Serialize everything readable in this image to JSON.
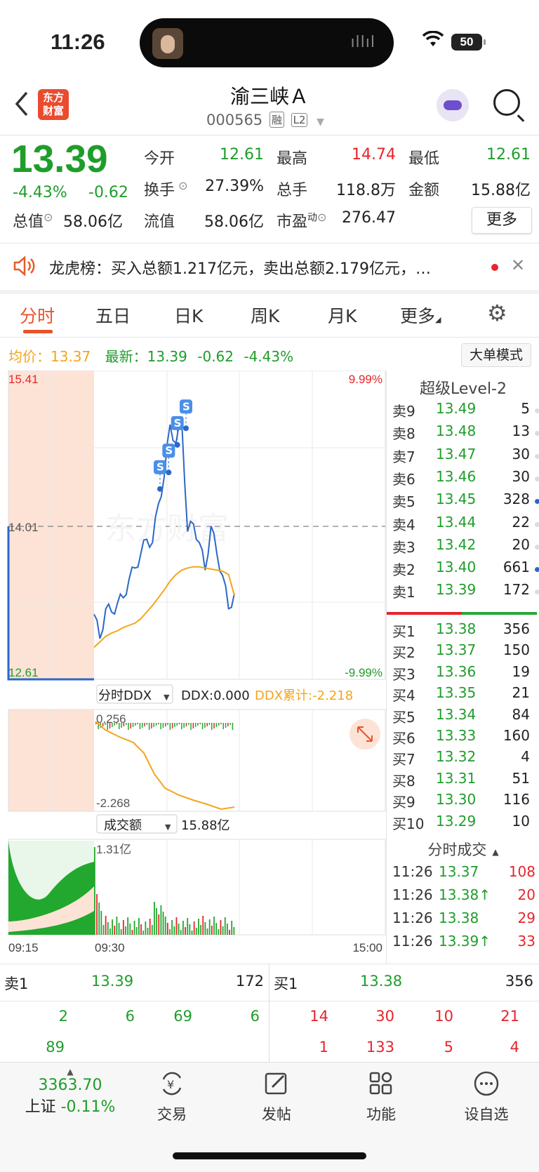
{
  "status": {
    "time": "11:26",
    "battery": "50"
  },
  "header": {
    "back_icon": "chevron-left-icon",
    "logo_line1": "东方",
    "logo_line2": "财富",
    "stock_name": "渝三峡Ａ",
    "stock_code": "000565",
    "tag_margin": "融",
    "tag_l2": "L2"
  },
  "quote": {
    "price": "13.39",
    "pct": "-4.43%",
    "change": "-0.62",
    "open_label": "今开",
    "open": "12.61",
    "high_label": "最高",
    "high": "14.74",
    "low_label": "最低",
    "low": "12.61",
    "turnover_label": "换手",
    "turnover": "27.39%",
    "volume_label": "总手",
    "volume": "118.8万",
    "amount_label": "金额",
    "amount": "15.88亿",
    "mktcap_label": "总值",
    "mktcap": "58.06亿",
    "float_label": "流值",
    "float": "58.06亿",
    "pe_label": "市盈",
    "pe_sup": "动",
    "pe": "276.47",
    "more_button": "更多"
  },
  "dragon_tiger": {
    "text": "龙虎榜：买入总额1.217亿元，卖出总额2.179亿元，…"
  },
  "tabs": [
    "分时",
    "五日",
    "日K",
    "周K",
    "月K",
    "更多"
  ],
  "intraday": {
    "avg_label": "均价：",
    "avg": "13.37",
    "latest_label": "最新：",
    "latest": "13.39",
    "change": "-0.62",
    "pct": "-4.43%",
    "big_order_button": "大单模式",
    "y_max": "15.41",
    "y_mid": "14.01",
    "y_min": "12.61",
    "pct_max": "9.99%",
    "pct_min": "-9.99%",
    "ddx_selector": "分时DDX",
    "ddx_value": "DDX:0.000",
    "ddx_cum": "DDX累计:-2.218",
    "ddx_top": "0.256",
    "ddx_bottom": "-2.268",
    "vol_selector": "成交额",
    "vol_total": "15.88亿",
    "vol_max": "1.31亿",
    "t_start": "09:15",
    "t_open": "09:30",
    "t_end": "15:00",
    "signal_label": "S"
  },
  "chart_data": {
    "type": "line",
    "title": "",
    "xlabel": "",
    "ylabel": "",
    "ylim": [
      12.61,
      15.41
    ],
    "x": [
      "09:30",
      "09:33",
      "09:36",
      "09:40",
      "09:45",
      "09:50",
      "09:55",
      "10:00",
      "10:05",
      "10:10",
      "10:15",
      "10:20",
      "10:25",
      "10:30",
      "10:35",
      "10:40",
      "10:45",
      "10:50",
      "10:55",
      "11:00",
      "11:05",
      "11:10",
      "11:15",
      "11:20",
      "11:26"
    ],
    "series": [
      {
        "name": "",
        "color": "#2c67c8",
        "values": [
          13.2,
          12.98,
          13.25,
          13.22,
          13.3,
          13.35,
          13.52,
          13.62,
          13.75,
          13.88,
          13.85,
          14.2,
          14.45,
          14.92,
          14.75,
          14.95,
          13.95,
          14.02,
          13.85,
          13.6,
          14.0,
          13.75,
          13.55,
          13.25,
          13.39
        ]
      },
      {
        "name": "",
        "color": "#f3a51b",
        "values": [
          12.9,
          12.95,
          13.0,
          13.03,
          13.05,
          13.08,
          13.1,
          13.12,
          13.16,
          13.22,
          13.28,
          13.35,
          13.42,
          13.5,
          13.56,
          13.6,
          13.62,
          13.63,
          13.63,
          13.62,
          13.61,
          13.6,
          13.59,
          13.56,
          13.37
        ]
      }
    ]
  },
  "order_book": {
    "title": "超级Level-2",
    "asks": [
      {
        "lv": "卖9",
        "p": "13.49",
        "v": "5",
        "dot": "gray"
      },
      {
        "lv": "卖8",
        "p": "13.48",
        "v": "13",
        "dot": "gray"
      },
      {
        "lv": "卖7",
        "p": "13.47",
        "v": "30",
        "dot": "gray"
      },
      {
        "lv": "卖6",
        "p": "13.46",
        "v": "30",
        "dot": "gray"
      },
      {
        "lv": "卖5",
        "p": "13.45",
        "v": "328",
        "dot": "blue"
      },
      {
        "lv": "卖4",
        "p": "13.44",
        "v": "22",
        "dot": "gray"
      },
      {
        "lv": "卖3",
        "p": "13.42",
        "v": "20",
        "dot": "gray"
      },
      {
        "lv": "卖2",
        "p": "13.40",
        "v": "661",
        "dot": "blue"
      },
      {
        "lv": "卖1",
        "p": "13.39",
        "v": "172",
        "dot": "gray"
      }
    ],
    "bids": [
      {
        "lv": "买1",
        "p": "13.38",
        "v": "356"
      },
      {
        "lv": "买2",
        "p": "13.37",
        "v": "150"
      },
      {
        "lv": "买3",
        "p": "13.36",
        "v": "19"
      },
      {
        "lv": "买4",
        "p": "13.35",
        "v": "21"
      },
      {
        "lv": "买5",
        "p": "13.34",
        "v": "84"
      },
      {
        "lv": "买6",
        "p": "13.33",
        "v": "160"
      },
      {
        "lv": "买7",
        "p": "13.32",
        "v": "4"
      },
      {
        "lv": "买8",
        "p": "13.31",
        "v": "51"
      },
      {
        "lv": "买9",
        "p": "13.30",
        "v": "116"
      },
      {
        "lv": "买10",
        "p": "13.29",
        "v": "10"
      }
    ],
    "ticks_title": "分时成交",
    "ticks": [
      {
        "t": "11:26",
        "p": "13.37",
        "v": "108"
      },
      {
        "t": "11:26",
        "p": "13.38↑",
        "v": "20"
      },
      {
        "t": "11:26",
        "p": "13.38",
        "v": "29"
      },
      {
        "t": "11:26",
        "p": "13.39↑",
        "v": "33"
      }
    ]
  },
  "level1": {
    "ask_label": "卖1",
    "ask_price": "13.39",
    "ask_vol": "172",
    "bid_label": "买1",
    "bid_price": "13.38",
    "bid_vol": "356",
    "ask_queue": [
      "2",
      "6",
      "69",
      "6",
      "89"
    ],
    "bid_queue": [
      "14",
      "30",
      "10",
      "21",
      "1",
      "133",
      "5",
      "4"
    ]
  },
  "nav": {
    "index_value": "3363.70",
    "index_name": "上证",
    "index_pct": "-0.11%",
    "items": [
      {
        "label": "交易",
        "icon": "yen-exchange-icon"
      },
      {
        "label": "发帖",
        "icon": "edit-icon"
      },
      {
        "label": "功能",
        "icon": "apps-grid-icon"
      },
      {
        "label": "设自选",
        "icon": "more-circle-icon"
      }
    ]
  },
  "colors": {
    "red": "#e8242c",
    "green": "#1f9d2b",
    "blue": "#2c67c8",
    "orange": "#f3a51b",
    "accent": "#e8542b"
  }
}
